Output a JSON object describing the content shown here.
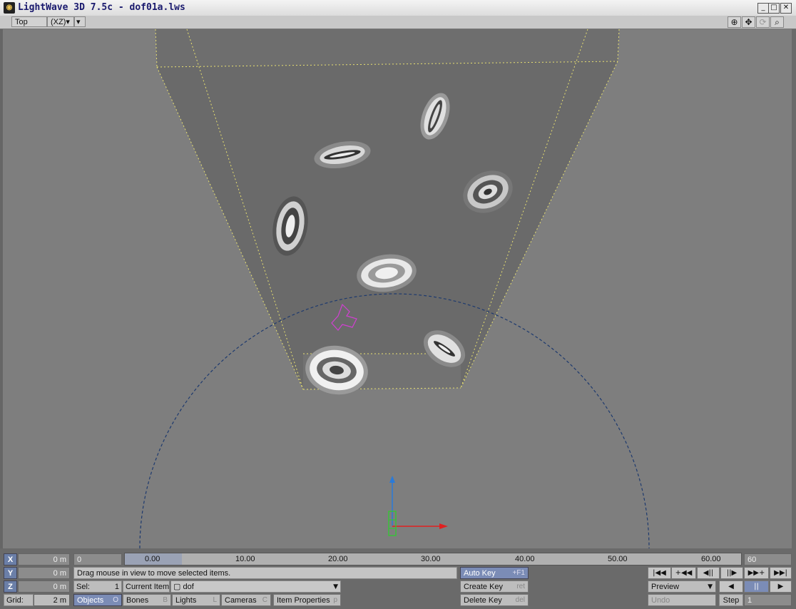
{
  "window": {
    "title": "LightWave 3D 7.5c - dof01a.lws",
    "minimize": "_",
    "maximize": "□",
    "close": "✕"
  },
  "viewbar": {
    "view": "Top",
    "axis": "(XZ)",
    "arrow": "▾",
    "menu": "▾"
  },
  "timeline": {
    "current": "0.00",
    "ticks": [
      "10.00",
      "20.00",
      "30.00",
      "40.00",
      "50.00",
      "60.00"
    ],
    "start": "0",
    "end": "60"
  },
  "coords": {
    "x_label": "X",
    "y_label": "Y",
    "z_label": "Z",
    "x": "0 m",
    "y": "0 m",
    "z": "0 m"
  },
  "status": "Drag mouse in view to move selected items.",
  "grid": {
    "label": "Grid:",
    "value": "2 m"
  },
  "sel": {
    "label": "Sel:",
    "value": "1"
  },
  "current_item": {
    "label": "Current Item",
    "value": "dof"
  },
  "tabs": [
    {
      "label": "Objects",
      "key": "O"
    },
    {
      "label": "Bones",
      "key": "B"
    },
    {
      "label": "Lights",
      "key": "L"
    },
    {
      "label": "Cameras",
      "key": "C"
    }
  ],
  "item_properties": {
    "label": "Item Properties",
    "key": "p"
  },
  "keys": {
    "auto_key": {
      "label": "Auto Key",
      "key": "+F1"
    },
    "create_key": {
      "label": "Create Key",
      "key": "ret"
    },
    "delete_key": {
      "label": "Delete Key",
      "key": "del"
    }
  },
  "transport": {
    "row1": [
      "|◀◀",
      "+◀◀",
      "◀||",
      "||▶",
      "▶▶+",
      "▶▶|"
    ],
    "preview": "Preview",
    "play_back": "◀",
    "pause": "||",
    "play": "▶",
    "undo": "Undo",
    "step_label": "Step",
    "step_value": "1"
  },
  "colors": {
    "accent": "#7b8cb6",
    "axis_blue": "#6b7fa8",
    "viewport": "#7e7e7e"
  }
}
